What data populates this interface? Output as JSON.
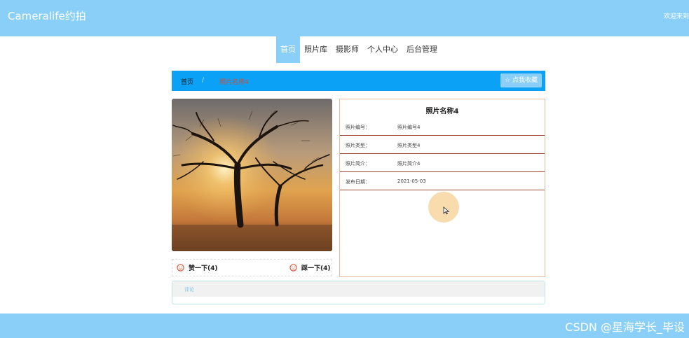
{
  "header": {
    "brand": "Cameralife约拍",
    "welcome": "欢迎来到"
  },
  "nav": {
    "items": [
      {
        "label": "首页",
        "active": true
      },
      {
        "label": "照片库",
        "active": false
      },
      {
        "label": "摄影师",
        "active": false
      },
      {
        "label": "个人中心",
        "active": false
      },
      {
        "label": "后台管理",
        "active": false
      }
    ]
  },
  "breadcrumb": {
    "home": "首页",
    "separator": "/",
    "current": "照片名称4",
    "favorite_label": "☆ 点我收藏"
  },
  "detail": {
    "title": "照片名称4",
    "fields": [
      {
        "label": "照片编号：",
        "value": "照片编号4"
      },
      {
        "label": "照片类型：",
        "value": "照片类型4"
      },
      {
        "label": "照片简介：",
        "value": "照片简介4"
      },
      {
        "label": "发布日期：",
        "value": "2021-05-03"
      }
    ]
  },
  "votes": {
    "up_label": "赞一下(4)",
    "down_label": "踩一下(4)"
  },
  "comments": {
    "title": "评论"
  },
  "footer": {
    "watermark": "CSDN @星海学长_毕设"
  },
  "colors": {
    "header": "#89cff8",
    "breadcrumb": "#0aa1f7",
    "accent_red": "#d84b2b"
  }
}
